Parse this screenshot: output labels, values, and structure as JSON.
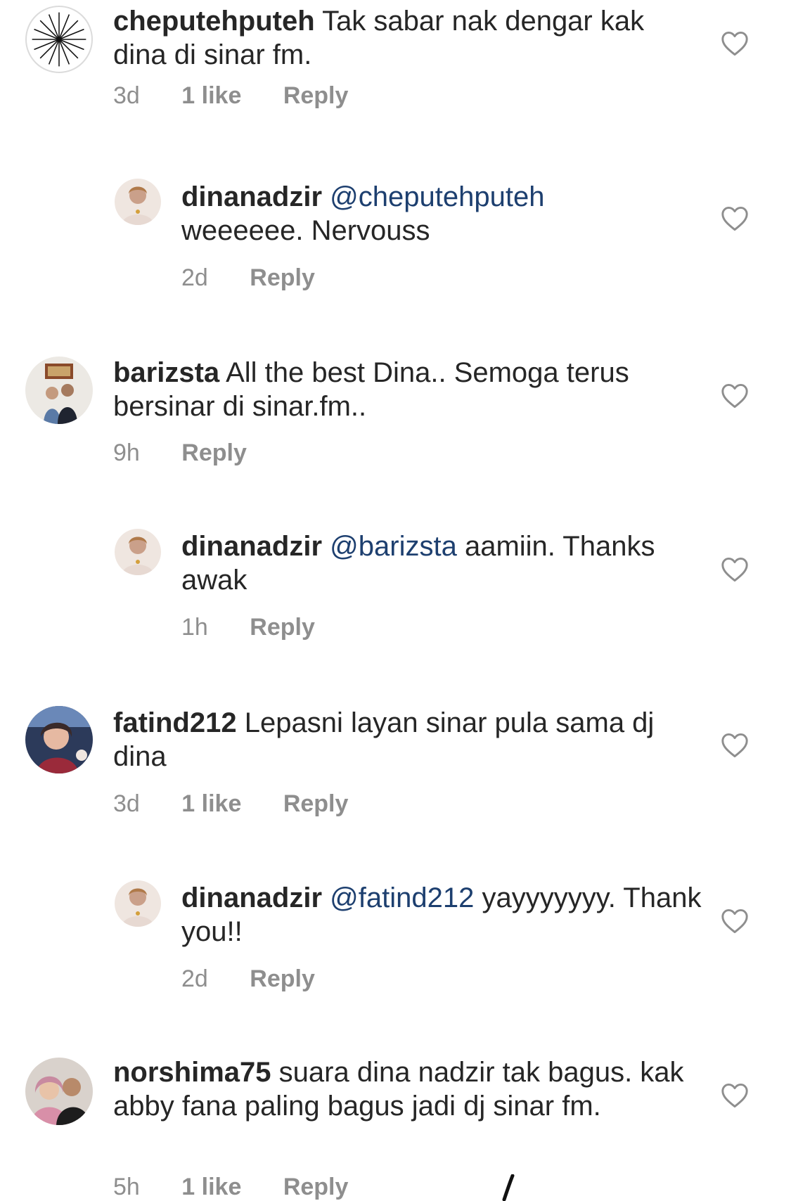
{
  "colors": {
    "text": "#262626",
    "mention": "#1d3f6f",
    "meta": "#8e8e8e",
    "heart_outline": "#8e8e8e"
  },
  "comments": [
    {
      "username": "cheputehputeh",
      "mention": "",
      "text": "Tak sabar nak dengar kak dina di sinar fm.",
      "time": "3d",
      "likes": "1 like",
      "reply_label": "Reply",
      "avatar": "spoke-wheel-avatar"
    },
    {
      "username": "dinanadzir",
      "mention": "@cheputehputeh",
      "text": "weeeeee. Nervouss",
      "time": "2d",
      "likes": "",
      "reply_label": "Reply",
      "avatar": "profile-photo-avatar"
    },
    {
      "username": "barizsta",
      "mention": "",
      "text": "All the best Dina.. Semoga terus bersinar di sinar.fm..",
      "time": "9h",
      "likes": "",
      "reply_label": "Reply",
      "avatar": "profile-photo-avatar"
    },
    {
      "username": "dinanadzir",
      "mention": "@barizsta",
      "text": "aamiin. Thanks awak",
      "time": "1h",
      "likes": "",
      "reply_label": "Reply",
      "avatar": "profile-photo-avatar"
    },
    {
      "username": "fatind212",
      "mention": "",
      "text": "Lepasni layan sinar pula sama dj dina",
      "time": "3d",
      "likes": "1 like",
      "reply_label": "Reply",
      "avatar": "profile-photo-avatar"
    },
    {
      "username": "dinanadzir",
      "mention": "@fatind212",
      "text": "yayyyyyyy. Thank you!!",
      "time": "2d",
      "likes": "",
      "reply_label": "Reply",
      "avatar": "profile-photo-avatar"
    },
    {
      "username": "norshima75",
      "mention": "",
      "text": "suara dina nadzir tak bagus. kak abby fana paling bagus jadi dj sinar fm.",
      "time": "5h",
      "likes": "1 like",
      "reply_label": "Reply",
      "avatar": "profile-photo-avatar"
    }
  ]
}
